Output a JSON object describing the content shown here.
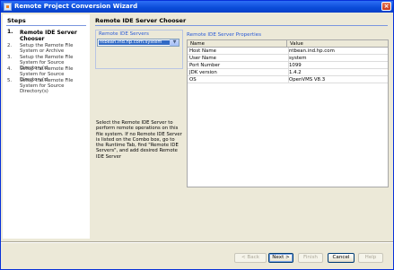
{
  "window": {
    "title": "Remote Project Conversion Wizard",
    "close_label": "×"
  },
  "steps": {
    "title": "Steps",
    "items": [
      {
        "num": "1.",
        "label": "Remote IDE Server Chooser"
      },
      {
        "num": "2.",
        "label": "Setup the Remote File System or Archive"
      },
      {
        "num": "3.",
        "label": "Setup the Remote File System for Source Directory(s)"
      },
      {
        "num": "4.",
        "label": "Setup the Remote File System for Source Directory(s)"
      },
      {
        "num": "5.",
        "label": "Setup the Remote File System for Source Directory(s)"
      }
    ]
  },
  "main": {
    "title": "Remote IDE Server Chooser",
    "servers_label": "Remote IDE Servers",
    "selected_server": "ntbean.ind.hp.com:system",
    "arrow": "▼",
    "properties_label": "Remote IDE Server Properties",
    "columns": [
      "Name",
      "Value"
    ],
    "rows": [
      [
        "Host Name",
        "ntbean.ind.hp.com"
      ],
      [
        "User Name",
        "system"
      ],
      [
        "Port Number",
        "1099"
      ],
      [
        "JDK version",
        "1.4.2"
      ],
      [
        "OS",
        "OpenVMS V8.3"
      ]
    ],
    "description": "Select the Remote IDE Server to perform remote operations on this file system. If no Remote IDE Server is listed on the Combo box, go to the Runtime Tab, find \"Remote IDE Servers\", and add desired Remote IDE Server"
  },
  "buttons": {
    "back": "< Back",
    "next": "Next >",
    "finish": "Finish",
    "cancel": "Cancel",
    "help": "Help"
  }
}
